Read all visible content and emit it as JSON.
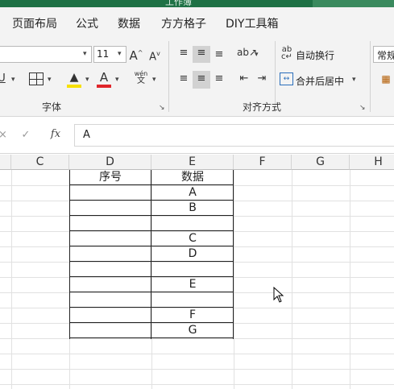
{
  "titlebar": {
    "title": "工作簿"
  },
  "tabs": [
    "页面布局",
    "公式",
    "数据",
    "方方格子",
    "DIY工具箱"
  ],
  "font_group": {
    "font_size": "11",
    "label": "字体"
  },
  "align_group": {
    "wrap_text": "自动换行",
    "merge_center": "合并后居中",
    "label": "对齐方式"
  },
  "number_group": {
    "format": "常规"
  },
  "formula_bar": {
    "value": "A"
  },
  "columns": [
    "C",
    "D",
    "E",
    "F",
    "G",
    "H"
  ],
  "table": {
    "headers": [
      "序号",
      "数据"
    ],
    "rows": [
      [
        "",
        "A"
      ],
      [
        "",
        "B"
      ],
      [
        "",
        ""
      ],
      [
        "",
        "C"
      ],
      [
        "",
        "D"
      ],
      [
        "",
        ""
      ],
      [
        "",
        "E"
      ],
      [
        "",
        ""
      ],
      [
        "",
        "F"
      ],
      [
        "",
        "G"
      ]
    ]
  },
  "colors": {
    "brand_green": "#1e7145",
    "font_color_red": "#e0262b",
    "highlight_yellow": "#f7e000"
  }
}
